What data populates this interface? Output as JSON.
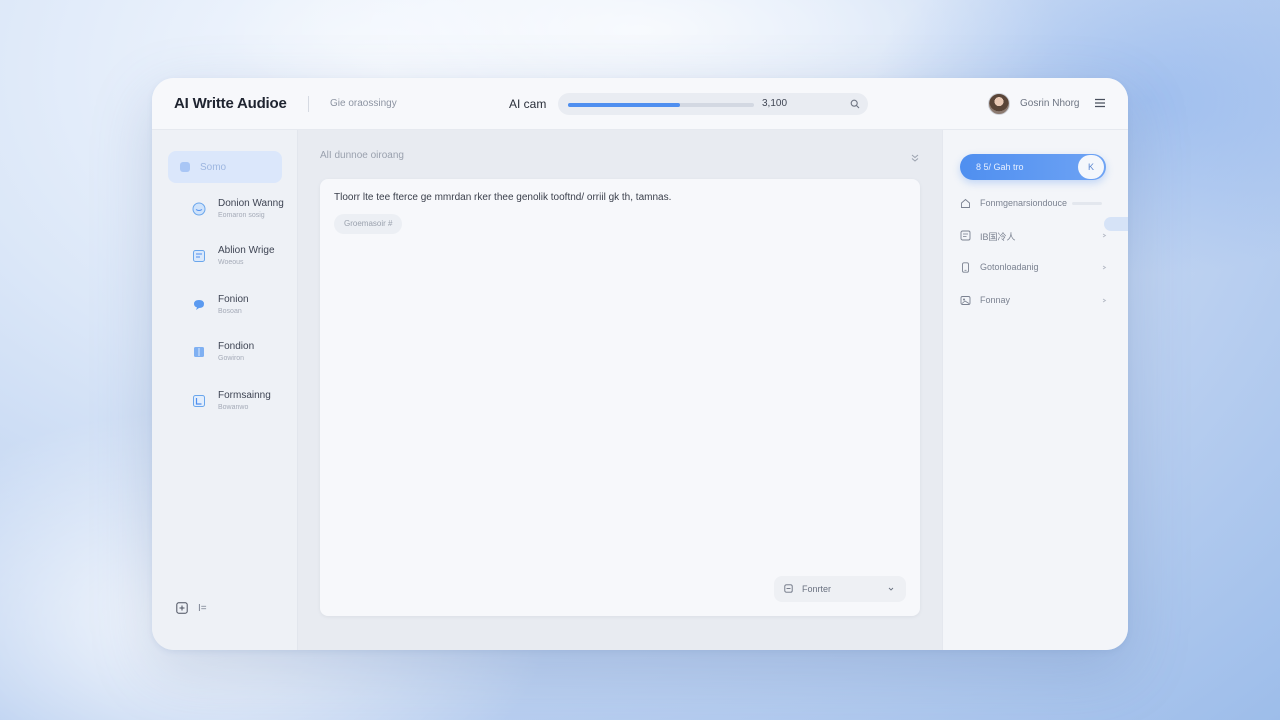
{
  "header": {
    "app_title": "AI Writte Audioe",
    "subtitle": "Gie oraossingy",
    "progress_label": "AI cam",
    "progress_count": "3,100",
    "progress_fraction": 0.6,
    "user_name": "Gosrin Nhorg"
  },
  "sidebar": {
    "active_item": "Somo",
    "items": [
      {
        "title": "Donion Wanng",
        "subtitle": "Eomaron sosig"
      },
      {
        "title": "Ablion Wrige",
        "subtitle": "Woeous"
      },
      {
        "title": "Fonion",
        "subtitle": "Bosoan"
      },
      {
        "title": "Fondion",
        "subtitle": "Gowiron"
      },
      {
        "title": "Formsainng",
        "subtitle": "Bowanwo"
      }
    ],
    "footer_label": "I="
  },
  "main": {
    "title": "AlI dunnoe oiroang",
    "editor_text": "Tloorr lte tee fterce ge mmrdan rker thee genolik tooftnd/ orriil gk th, tamnas.",
    "editor_chip": "Groemasoir #",
    "format_label": "Fonrter"
  },
  "right_panel": {
    "generate_label": "8 5/ Gah tro",
    "generate_knob": "K",
    "options": [
      {
        "label": "Fonmgenarsiondouce"
      },
      {
        "label": "IB国冷人"
      },
      {
        "label": "Gotonloadanig"
      },
      {
        "label": "Fonnay"
      }
    ]
  },
  "colors": {
    "accent": "#4f8ff0",
    "window_bg": "#f3f5f9"
  }
}
